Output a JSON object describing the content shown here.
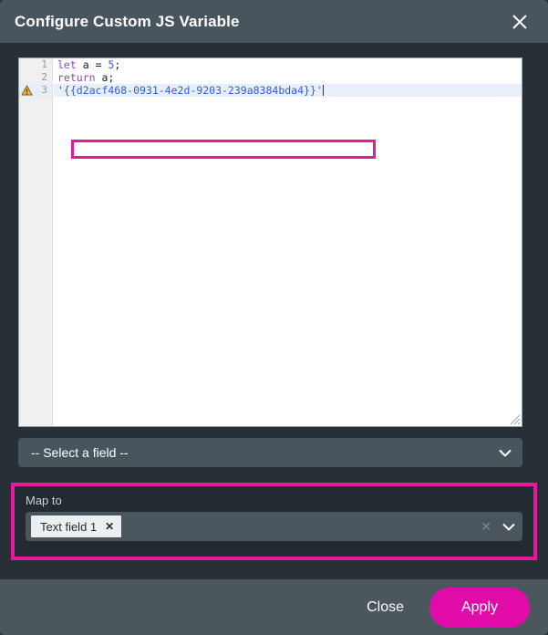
{
  "window": {
    "title": "Configure Custom JS Variable",
    "close_icon": "close-icon"
  },
  "editor": {
    "gutter": [
      {
        "number": "1",
        "has_warning": false
      },
      {
        "number": "2",
        "has_warning": false
      },
      {
        "number": "3",
        "has_warning": true
      }
    ],
    "warning_icon": "warning-triangle-icon",
    "resize_icon": "resize-grip-icon",
    "lines": [
      {
        "number": "1",
        "tokens": [
          {
            "text": "let",
            "type": "kw"
          },
          {
            "text": " a ",
            "type": "plain"
          },
          {
            "text": "=",
            "type": "plain"
          },
          {
            "text": " ",
            "type": "plain"
          },
          {
            "text": "5",
            "type": "num"
          },
          {
            "text": ";",
            "type": "plain"
          }
        ]
      },
      {
        "number": "2",
        "tokens": [
          {
            "text": "return",
            "type": "kw"
          },
          {
            "text": " a;",
            "type": "plain"
          }
        ]
      },
      {
        "number": "3",
        "active": true,
        "tokens": [
          {
            "text": "'{{d2acf468-0931-4e2d-9203-239a8384bda4}}'",
            "type": "str"
          }
        ]
      }
    ],
    "plain_text": "let a = 5;\nreturn a;\n'{{d2acf468-0931-4e2d-9203-239a8384bda4}}'"
  },
  "select_field": {
    "value": "-- Select a field --",
    "chevron_icon": "chevron-down-icon"
  },
  "map_to": {
    "label": "Map to",
    "tags": [
      {
        "label": "Text field 1",
        "remove_icon": "remove-tag-icon",
        "remove_glyph": "✕"
      }
    ],
    "clear_glyph": "✕",
    "chevron_icon": "chevron-down-icon"
  },
  "footer": {
    "close_label": "Close",
    "apply_label": "Apply"
  },
  "colors": {
    "accent_magenta": "#e5189f",
    "apply_button": "#e10ba9",
    "titlebar": "#49555c",
    "dialog_body": "#272f37",
    "footer": "#4c565d",
    "panel_inner": "#232b32",
    "control": "#4a555d",
    "active_line": "#e8effa",
    "keyword": "#9b3fbf",
    "string": "#2f5fd0",
    "warning": "#f0a830"
  }
}
